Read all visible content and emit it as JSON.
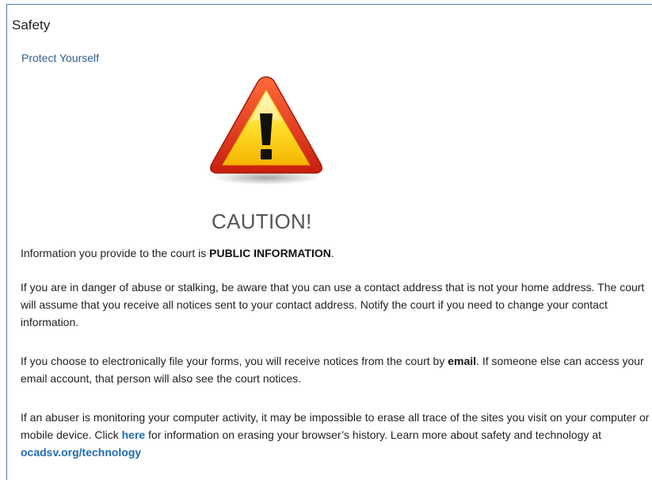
{
  "panel": {
    "title": "Safety",
    "subtitle_link": "Protect Yourself"
  },
  "warning": {
    "icon": "warning-triangle-icon",
    "heading": "CAUTION!"
  },
  "paragraphs": {
    "p1": {
      "pre": "Information you provide to the court is ",
      "bold": "PUBLIC INFORMATION",
      "post": "."
    },
    "p2": {
      "text": "If you are in danger of abuse or stalking, be aware that you can use a contact address that is not your home address. The court will assume that you receive all notices sent to your contact address. Notify the court if you need to change your contact information."
    },
    "p3": {
      "pre": "If you choose to electronically file your forms, you will receive notices from the court by ",
      "bold": "email",
      "post": ". If someone else can access your email account, that person will also see the court notices."
    },
    "p4": {
      "pre": "If an abuser is monitoring your computer activity, it may be impossible to erase all trace of the sites you visit on your computer or mobile device. Click ",
      "link": "here",
      "mid": " for information on erasing your browser’s history. Learn more about safety and technology at ",
      "link2": "ocadsv.org/technology"
    }
  },
  "colors": {
    "border": "#4a7cb5",
    "link": "#1f6cb0",
    "warning_red": "#e0301e",
    "warning_yellow": "#ffd21f"
  }
}
